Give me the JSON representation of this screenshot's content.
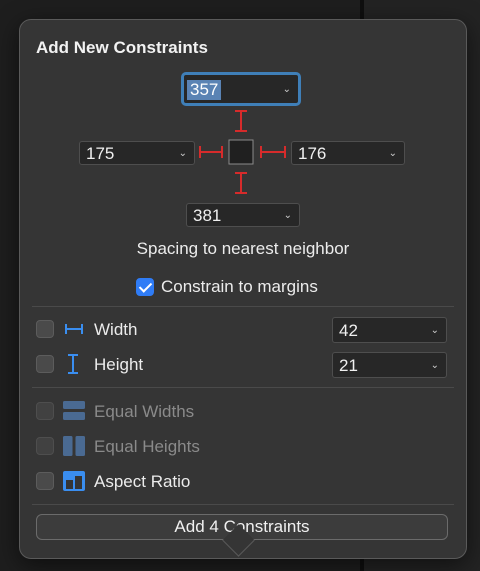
{
  "popover": {
    "title": "Add New Constraints",
    "spacing": {
      "top": "357",
      "left": "175",
      "right": "176",
      "bottom": "381",
      "caption": "Spacing to nearest neighbor"
    },
    "constrain_margins": {
      "label": "Constrain to margins",
      "checked": true
    },
    "width": {
      "label": "Width",
      "value": "42",
      "checked": false,
      "icon": "width-icon"
    },
    "height": {
      "label": "Height",
      "value": "21",
      "checked": false,
      "icon": "height-icon"
    },
    "equal_widths": {
      "label": "Equal Widths",
      "enabled": false,
      "icon": "equal-widths-icon"
    },
    "equal_heights": {
      "label": "Equal Heights",
      "enabled": false,
      "icon": "equal-heights-icon"
    },
    "aspect_ratio": {
      "label": "Aspect Ratio",
      "checked": false,
      "icon": "aspect-ratio-icon"
    },
    "add_button": "Add 4 Constraints",
    "colors": {
      "accent": "#2f7cf6",
      "strut": "#d62b2b",
      "icon_blue": "#3a8ef0",
      "focus": "#3f7fb8"
    }
  }
}
